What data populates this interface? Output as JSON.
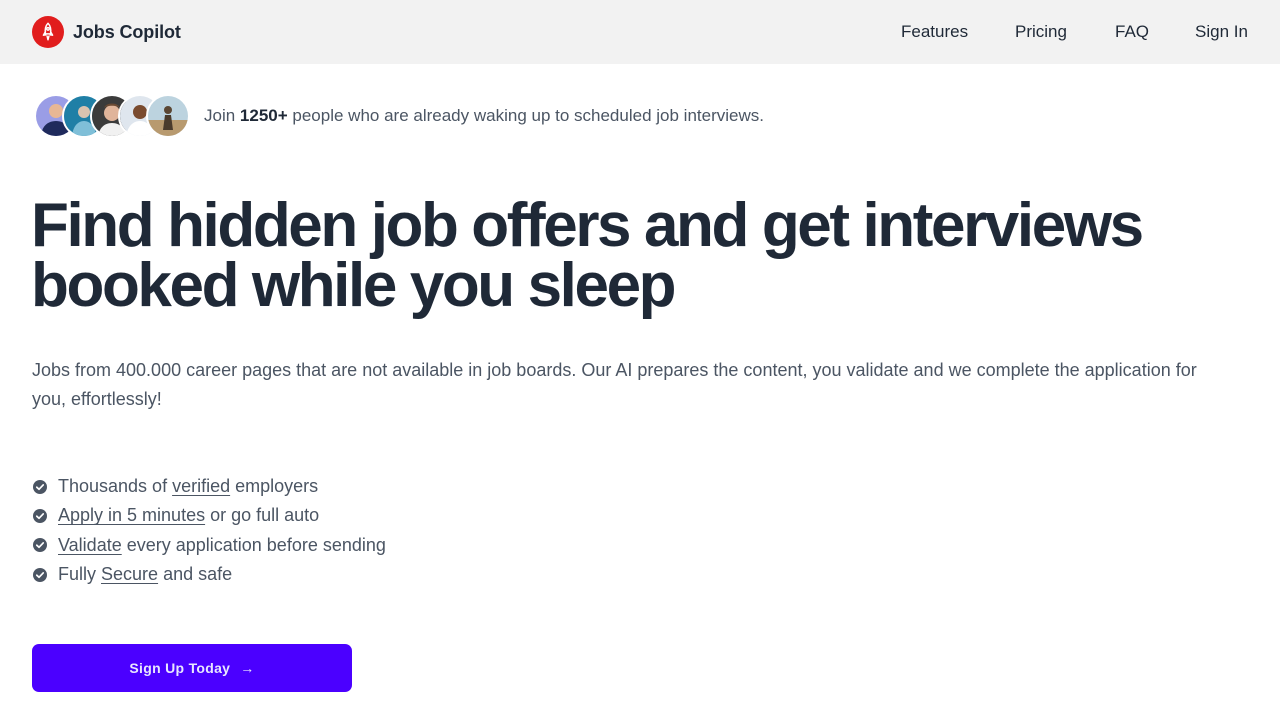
{
  "header": {
    "brand_name": "Jobs Copilot",
    "logo_icon": "rocket-icon",
    "logo_color": "#e11d1d",
    "nav": {
      "features": "Features",
      "pricing": "Pricing",
      "faq": "FAQ",
      "sign_in": "Sign In"
    }
  },
  "social_proof": {
    "prefix": "Join ",
    "count": "1250+",
    "suffix": " people who are already waking up to scheduled job interviews."
  },
  "hero": {
    "headline": "Find hidden job offers and get interviews booked while you sleep",
    "subtext": "Jobs from 400.000 career pages that are not available in job boards. Our AI prepares the content, you validate and we complete the application for you, effortlessly!"
  },
  "features": [
    {
      "before": "Thousands of ",
      "link": "verified",
      "after": " employers"
    },
    {
      "before": "",
      "link": "Apply in 5 minutes",
      "after": " or go full auto"
    },
    {
      "before": "",
      "link": "Validate",
      "after": " every application before sending"
    },
    {
      "before": "Fully ",
      "link": "Secure",
      "after": " and safe"
    }
  ],
  "cta": {
    "label": "Sign Up Today",
    "icon": "arrow-right-icon",
    "color": "#4b00ff"
  }
}
